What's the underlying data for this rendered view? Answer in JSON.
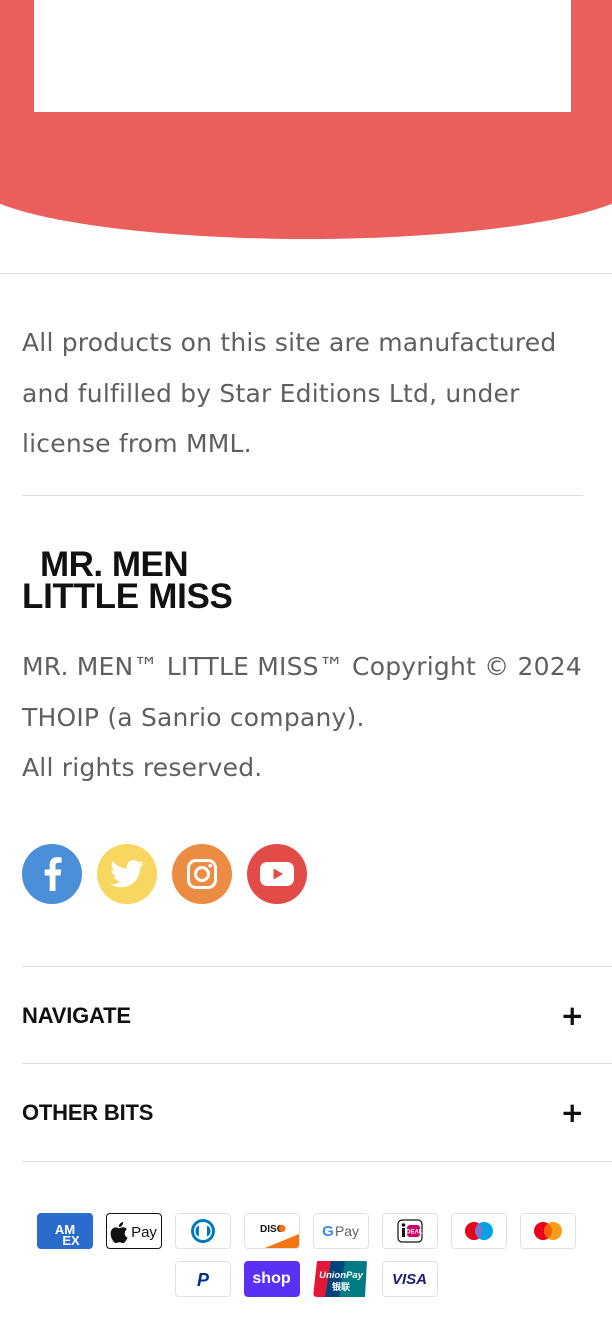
{
  "footer": {
    "license_text": "All products on this site are manufactured and fulfilled by Star Editions Ltd, under license from MML.",
    "logo": {
      "line1": "MR. MEN",
      "line2": "LITTLE MISS"
    },
    "copyright_lines": [
      "MR. MEN™ LITTLE MISS™ Copyright © 2024",
      "THOIP (a Sanrio company).",
      "All rights reserved."
    ],
    "social": [
      {
        "name": "facebook-icon",
        "color": "#4a8fd8"
      },
      {
        "name": "twitter-icon",
        "color": "#f7d760"
      },
      {
        "name": "instagram-icon",
        "color": "#ec8b42"
      },
      {
        "name": "youtube-icon",
        "color": "#e24b48"
      }
    ],
    "accordions": [
      {
        "label": "NAVIGATE",
        "toggle": "+"
      },
      {
        "label": "OTHER BITS",
        "toggle": "+"
      }
    ],
    "payment_methods": [
      {
        "name": "American Express",
        "text": "AM EX"
      },
      {
        "name": "Apple Pay",
        "text": "Pay"
      },
      {
        "name": "Diners Club",
        "text": ""
      },
      {
        "name": "Discover",
        "text": "DISC VER"
      },
      {
        "name": "Google Pay",
        "text": "Pay"
      },
      {
        "name": "iDEAL",
        "text": "iDEAL"
      },
      {
        "name": "Maestro",
        "text": ""
      },
      {
        "name": "Mastercard",
        "text": ""
      },
      {
        "name": "PayPal",
        "text": "P"
      },
      {
        "name": "Shop Pay",
        "text": "shop"
      },
      {
        "name": "UnionPay",
        "text": "UnionPay"
      },
      {
        "name": "Visa",
        "text": "VISA"
      }
    ]
  },
  "colors": {
    "hero_red": "#ea5f5b",
    "text_grey": "#5f5f5f",
    "divider": "#dcdcdc"
  }
}
